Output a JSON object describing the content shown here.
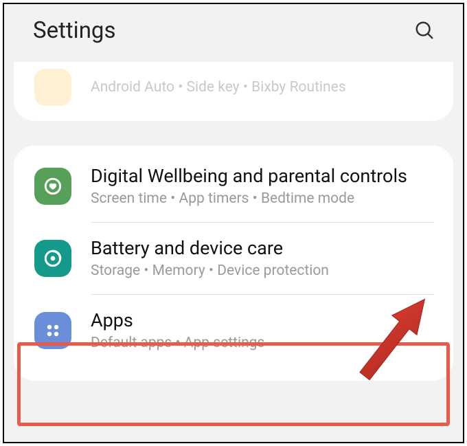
{
  "header": {
    "title": "Settings"
  },
  "partial_row": {
    "subtitle": "Android Auto  •  Side key  •  Bixby Routines"
  },
  "rows": [
    {
      "title": "Digital Wellbeing and parental controls",
      "subtitle": "Screen time  •  App timers  •  Bedtime mode"
    },
    {
      "title": "Battery and device care",
      "subtitle": "Storage  •  Memory  •  Device protection"
    },
    {
      "title": "Apps",
      "subtitle": "Default apps  •  App settings"
    }
  ]
}
